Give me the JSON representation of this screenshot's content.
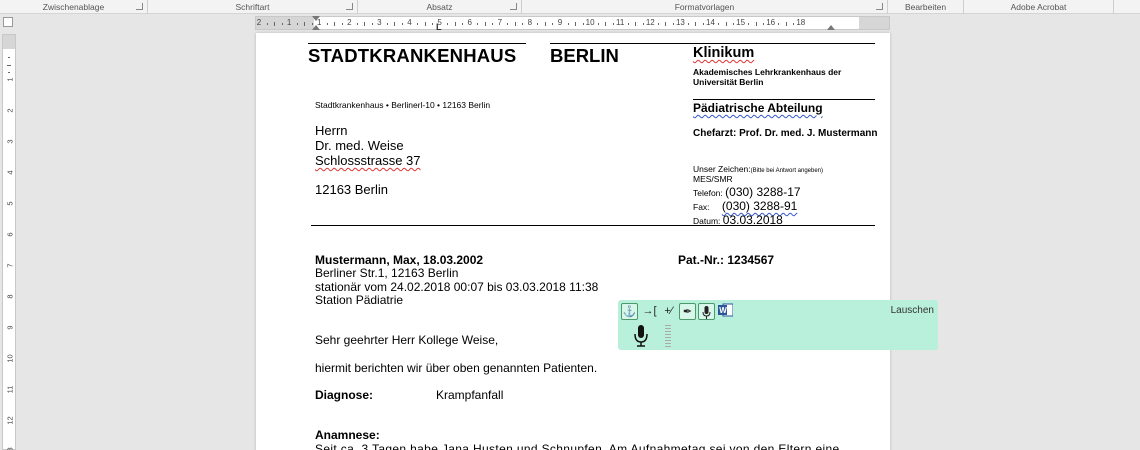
{
  "ribbon": {
    "groups": [
      {
        "label": "Zwischenablage"
      },
      {
        "label": "Schriftart"
      },
      {
        "label": "Absatz"
      },
      {
        "label": "Formatvorlagen"
      },
      {
        "label": "Bearbeiten"
      },
      {
        "label": "Adobe Acrobat"
      }
    ]
  },
  "ruler": {
    "h_numbers": [
      "2",
      "1",
      "1",
      "2",
      "3",
      "4",
      "5",
      "6",
      "7",
      "8",
      "9",
      "10",
      "11",
      "12",
      "13",
      "14",
      "15",
      "16",
      "18"
    ],
    "v_numbers": [
      "1",
      "2",
      "3",
      "4",
      "5",
      "6",
      "7",
      "8",
      "9",
      "10",
      "11",
      "12",
      "13"
    ]
  },
  "letter": {
    "hospital_name": "STADTKRANKENHAUS",
    "hospital_city": "BERLIN",
    "klinikum": "Klinikum",
    "akad": "Akademisches Lehrkrankenhaus der Universität Berlin",
    "sender_line": "Stadtkrankenhaus  •  Berlinerl-10  •  12163 Berlin",
    "department": "Pädiatrische  Abteilung",
    "chief": "Chefarzt: Prof. Dr. med. J. Mustermann",
    "recipient": {
      "salutation": "Herrn",
      "name": "Dr. med. Weise",
      "street": "Schlossstrasse 37",
      "city": "12163 Berlin"
    },
    "ref": {
      "label": "Unser Zeichen:",
      "note": "(Bitte bei Antwort angeben)",
      "value": "MES/SMR",
      "telefon_label": "Telefon:",
      "telefon": "(030) 3288-17",
      "fax_label": "Fax:",
      "fax": "(030) 3288-91",
      "datum_label": "Datum:",
      "datum": "03.03.2018"
    },
    "patient": {
      "name_line": "Mustermann, Max, 18.03.2002",
      "pat_nr": "Pat.-Nr.: 1234567",
      "address": "Berliner Str.1, 12163 Berlin",
      "stay": "stationär vom 24.02.2018 00:07 bis 03.03.2018 11:38",
      "station": "Station Pädiatrie"
    },
    "greeting": "Sehr geehrter Herr Kollege Weise,",
    "intro": "hiermit berichten wir über oben genannten Patienten.",
    "diagnose_label": "Diagnose:",
    "diagnose_value": "Krampfanfall",
    "anamnese_label": "Anamnese:",
    "anamnese_text": "Seit ca. 3 Tagen habe Jana Husten und Schnupfen. Am Aufnahmetag sei von den Eltern eine"
  },
  "dictation": {
    "status_label": "Lauschen",
    "accent": "#b9f0dc"
  }
}
